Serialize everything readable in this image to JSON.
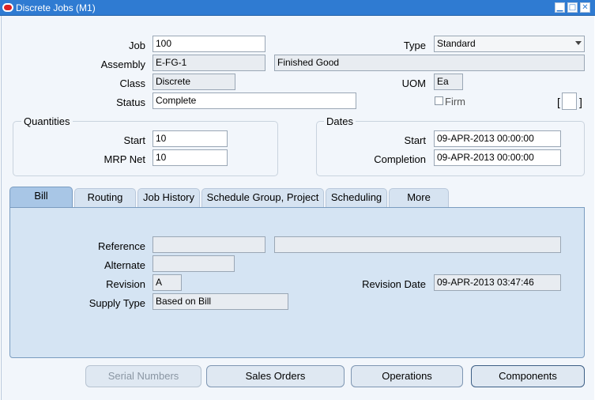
{
  "window": {
    "title": "Discrete Jobs (M1)",
    "min_icon": "minimize-icon",
    "max_icon": "maximize-icon",
    "close_icon": "close-icon"
  },
  "header": {
    "job_label": "Job",
    "job_value": "100",
    "type_label": "Type",
    "type_value": "Standard",
    "assembly_label": "Assembly",
    "assembly_value": "E-FG-1",
    "assembly_desc": "Finished Good",
    "class_label": "Class",
    "class_value": "Discrete",
    "uom_label": "UOM",
    "uom_value": "Ea",
    "status_label": "Status",
    "status_value": "Complete",
    "firm_label": "Firm",
    "flex_open": "[",
    "flex_close": "]"
  },
  "quantities": {
    "title": "Quantities",
    "start_label": "Start",
    "start_value": "10",
    "mrp_label": "MRP Net",
    "mrp_value": "10"
  },
  "dates": {
    "title": "Dates",
    "start_label": "Start",
    "start_value": "09-APR-2013 00:00:00",
    "completion_label": "Completion",
    "completion_value": "09-APR-2013 00:00:00"
  },
  "tabs": [
    {
      "label": "Bill"
    },
    {
      "label": "Routing"
    },
    {
      "label": "Job History"
    },
    {
      "label": "Schedule Group, Project"
    },
    {
      "label": "Scheduling"
    },
    {
      "label": "More"
    }
  ],
  "bill": {
    "reference_label": "Reference",
    "reference_value": "",
    "reference_desc": "",
    "alternate_label": "Alternate",
    "alternate_value": "",
    "revision_label": "Revision",
    "revision_value": "A",
    "revision_date_label": "Revision Date",
    "revision_date_value": "09-APR-2013 03:47:46",
    "supply_type_label": "Supply Type",
    "supply_type_value": "Based on Bill"
  },
  "buttons": {
    "serial_numbers": "Serial Numbers",
    "sales_orders": "Sales Orders",
    "operations": "Operations",
    "components": "Components"
  }
}
